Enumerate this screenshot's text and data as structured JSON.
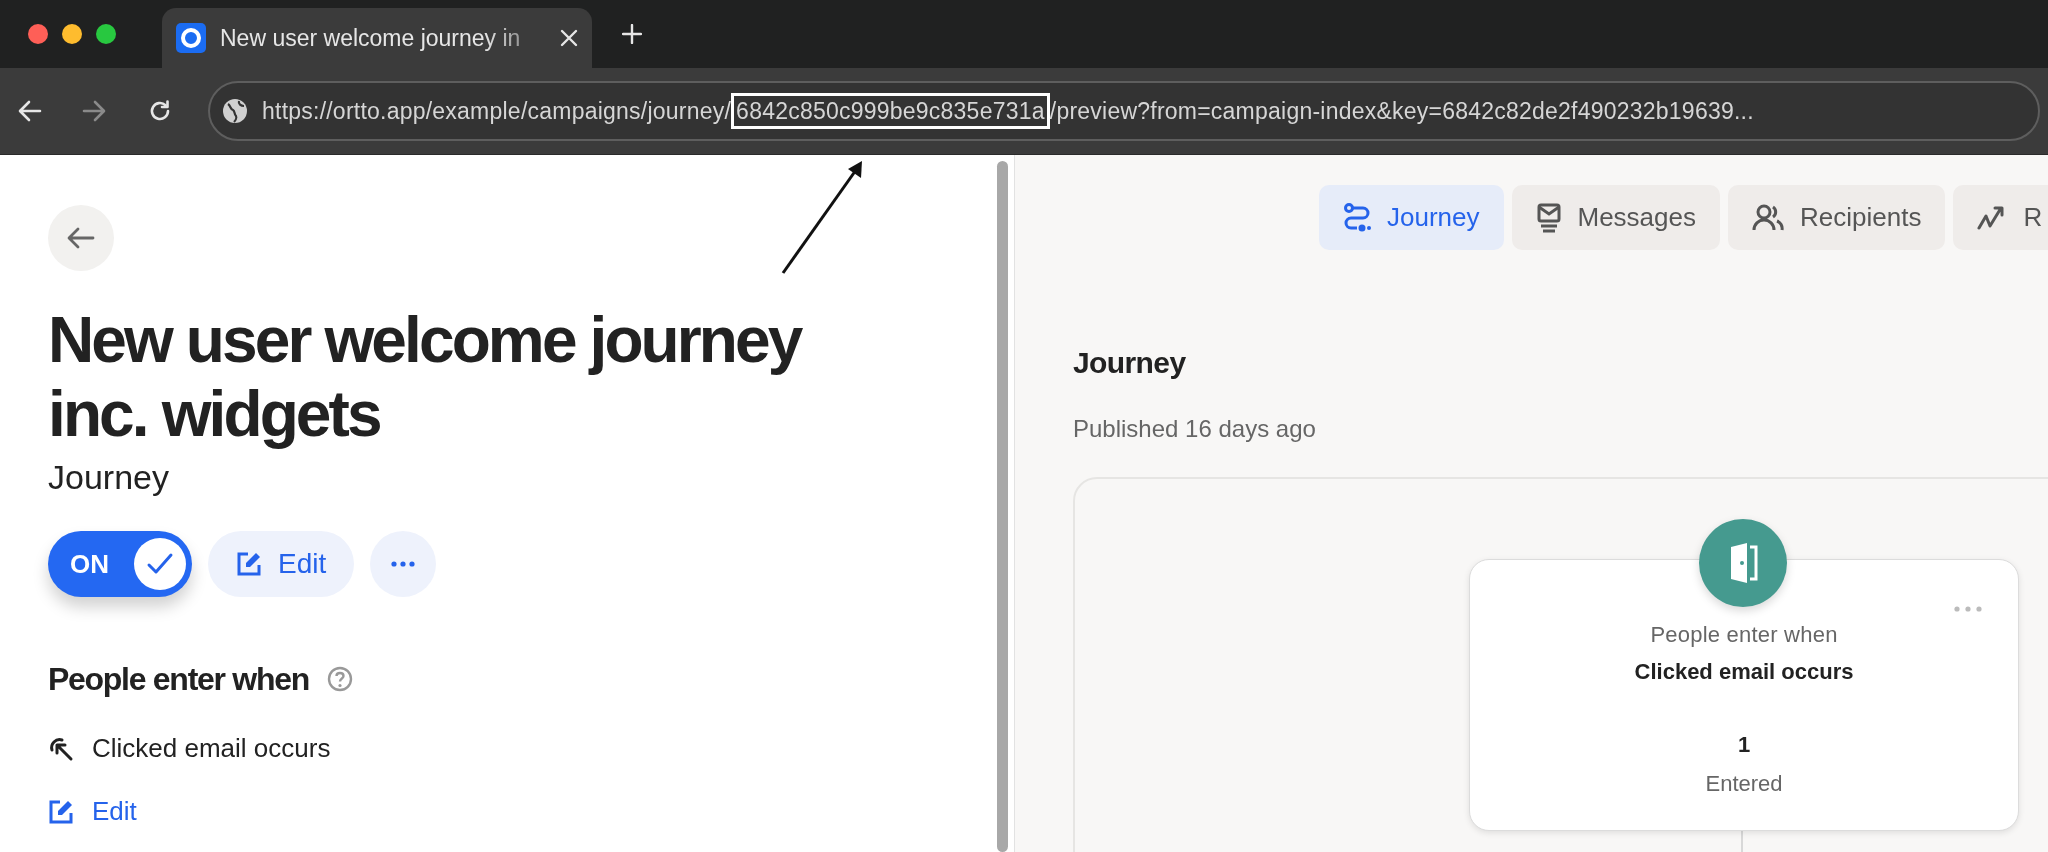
{
  "browser": {
    "tab": {
      "title": "New user welcome journey in"
    },
    "url": {
      "before": "https://ortto.app/example/campaigns/journey/",
      "highlighted": "6842c850c999be9c835e731a",
      "after": "/preview?from=campaign-index&key=6842c82de2f490232b19639..."
    }
  },
  "campaign": {
    "title": "New user welcome journey inc. widgets",
    "type": "Journey",
    "toggle": {
      "label": "ON",
      "on": true
    },
    "edit_button": "Edit",
    "section_title": "People enter when",
    "trigger": "Clicked email occurs",
    "edit_link": "Edit"
  },
  "tabs": [
    {
      "kind": "journey",
      "label": "Journey",
      "selected": true
    },
    {
      "kind": "messages",
      "label": "Messages",
      "selected": false
    },
    {
      "kind": "recipients",
      "label": "Recipients",
      "selected": false
    },
    {
      "kind": "reports",
      "label": "R",
      "selected": false
    }
  ],
  "journey": {
    "heading": "Journey",
    "published": "Published 16 days ago",
    "node": {
      "label": "People enter when",
      "trigger": "Clicked email occurs",
      "count": "1",
      "count_label": "Entered"
    }
  }
}
